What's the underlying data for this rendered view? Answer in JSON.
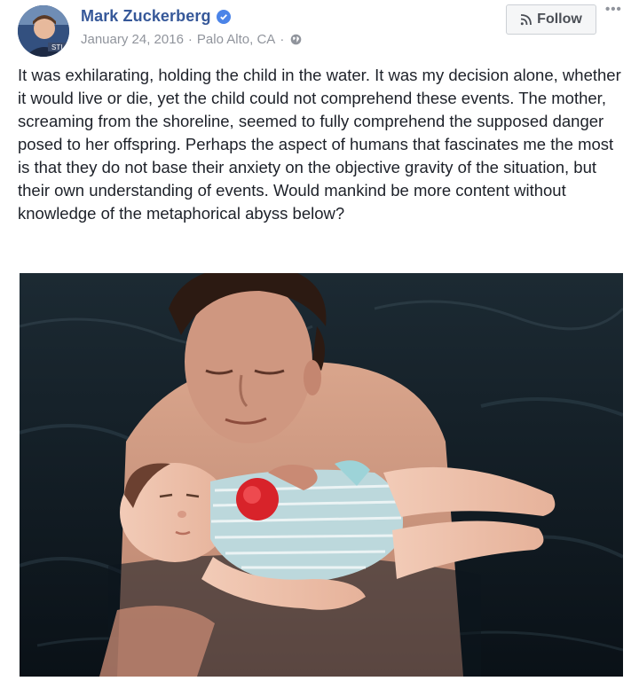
{
  "post": {
    "author": {
      "name": "Mark Zuckerberg",
      "verified": true,
      "avatar_icon": "profile-photo"
    },
    "date": "January 24, 2016",
    "location": "Palo Alto, CA",
    "separator": "·",
    "privacy_icon": "globe-icon",
    "follow_label": "Follow",
    "more_label": "•••",
    "text": "It was exhilarating, holding the child in the water. It was my decision alone, whether it would live or die, yet the child could not comprehend these events. The mother, screaming from the shoreline, seemed to fully comprehend the supposed danger posed to her offspring. Perhaps the aspect of humans that fascinates me the most is that they do not base their anxiety on the objective gravity of the situation, but their own understanding of events. Would mankind be more content without knowledge of the metaphorical abyss below?"
  },
  "colors": {
    "name_link": "#365899",
    "meta_text": "#90949c",
    "verified_badge": "#4b84e8",
    "water": "#0f1a22",
    "body_text": "#1d2129"
  }
}
